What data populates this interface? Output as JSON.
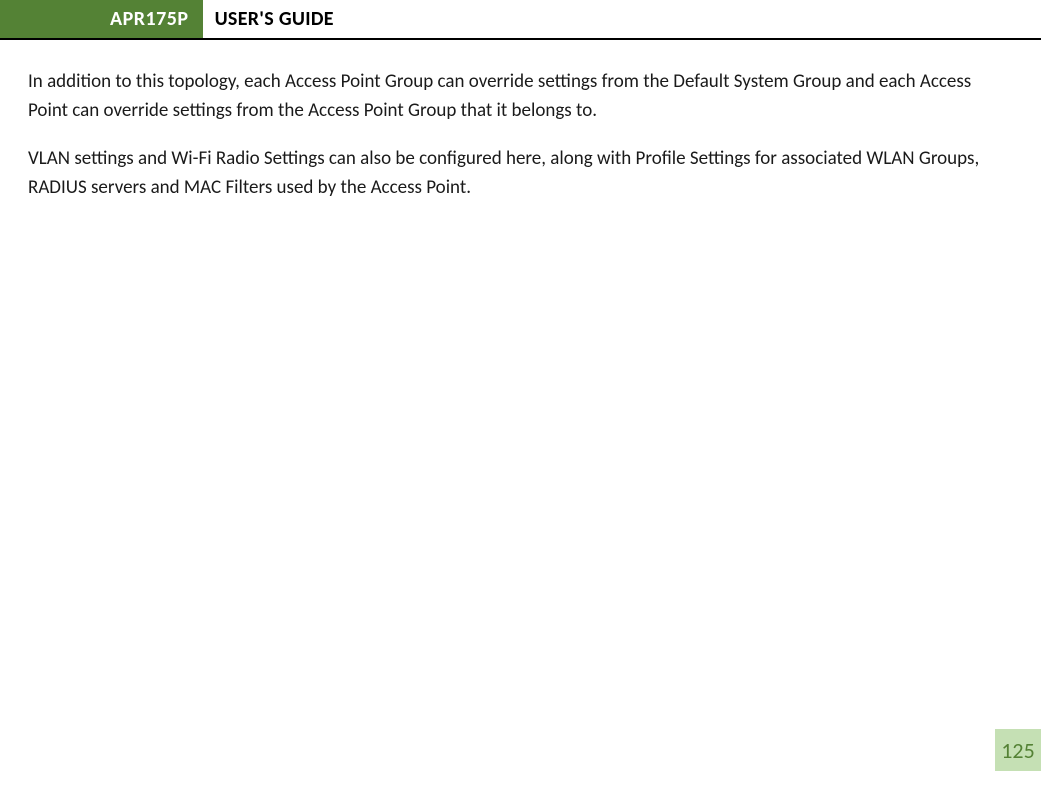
{
  "header": {
    "model": "APR175P",
    "title": "USER'S GUIDE"
  },
  "body": {
    "p1": "In addition to this topology, each Access Point Group can override settings from the Default System Group and each Access Point can override settings from the Access Point Group that it belongs to.",
    "p2": "VLAN settings and Wi-Fi Radio Settings can also be configured here, along with Profile Settings for associated WLAN Groups, RADIUS servers and MAC Filters used by the Access Point."
  },
  "page_number": "125"
}
